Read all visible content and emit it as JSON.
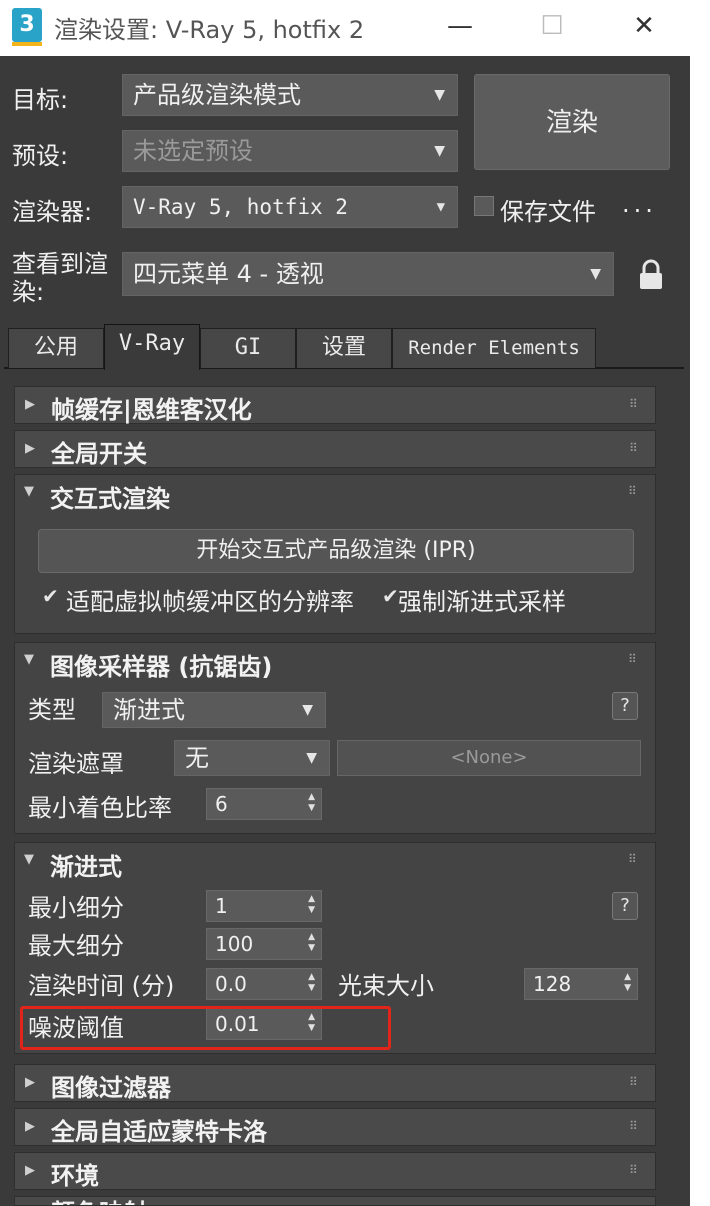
{
  "window": {
    "app_icon": "3",
    "title": "渲染设置: V-Ray 5, hotfix 2",
    "minimize": "—",
    "maximize": "☐",
    "close": "✕"
  },
  "form": {
    "target_label": "目标:",
    "target_value": "产品级渲染模式",
    "preset_label": "预设:",
    "preset_value": "未选定预设",
    "renderer_label": "渲染器:",
    "renderer_value": "V-Ray 5, hotfix 2",
    "view_label_1": "查看到渲",
    "view_label_2": "染:",
    "view_value": "四元菜单 4 - 透视",
    "render_button": "渲染",
    "save_file_label": "保存文件",
    "more": "..."
  },
  "tabs": [
    {
      "label": "公用"
    },
    {
      "label": "V-Ray"
    },
    {
      "label": "GI"
    },
    {
      "label": "设置"
    },
    {
      "label": "Render Elements"
    }
  ],
  "rollouts": {
    "frame_buffer": "帧缓存|恩维客汉化",
    "global_switches": "全局开关",
    "interactive": "交互式渲染",
    "ipr_button": "开始交互式产品级渲染 (IPR)",
    "fit_resolution": "适配虚拟帧缓冲区的分辨率",
    "force_progressive": "强制渐进式采样",
    "image_sampler": "图像采样器 (抗锯齿)",
    "type_label": "类型",
    "type_value": "渐进式",
    "render_mask_label": "渲染遮罩",
    "render_mask_value": "无",
    "render_mask_none": "<None>",
    "min_shading_label": "最小着色比率",
    "min_shading_value": "6",
    "progressive": "渐进式",
    "min_subdivs_label": "最小细分",
    "min_subdivs_value": "1",
    "max_subdivs_label": "最大细分",
    "max_subdivs_value": "100",
    "render_time_label": "渲染时间 (分)",
    "render_time_value": "0.0",
    "bundle_size_label": "光束大小",
    "bundle_size_value": "128",
    "noise_label": "噪波阈值",
    "noise_value": "0.01",
    "image_filter": "图像过滤器",
    "global_dmc": "全局自适应蒙特卡洛",
    "environment": "环境",
    "color_mapping": "颜色映射"
  },
  "help": "?",
  "colors": {
    "panel_bg": "#3a3a3a",
    "highlight": "#e1251b"
  },
  "icons": {
    "lock": "lock-icon",
    "expand": "triangle-right-icon",
    "collapse": "triangle-down-icon"
  }
}
